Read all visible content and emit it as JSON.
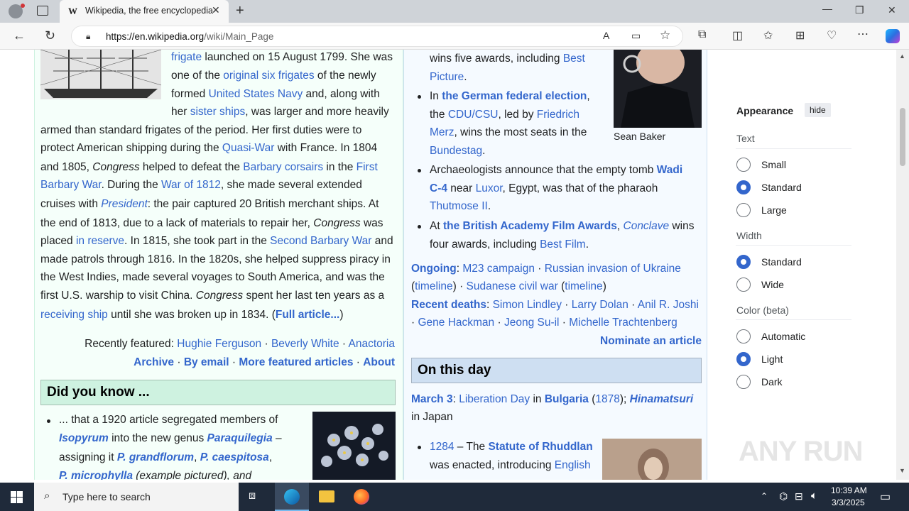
{
  "browser": {
    "tab_title": "Wikipedia, the free encyclopedia",
    "tab_icon": "W",
    "url_host": "https://en.wikipedia.org",
    "url_path": "/wiki/Main_Page"
  },
  "featured": {
    "l1a": "frigate",
    "l1b": " launched on 15 August 1799. She was",
    "l2a": "one of the ",
    "l2b": "original six frigates",
    "l2c": " of the newly",
    "l3a": "formed ",
    "l3b": "United States Navy",
    "l3c": " and, along with",
    "l4a": "her ",
    "l4b": "sister ships",
    "l4c": ", was larger and more heavily",
    "l5": "armed than standard frigates of the period. Her first duties were to",
    "l6a": "protect American shipping during the ",
    "l6b": "Quasi-War",
    "l6c": " with France. In 1804",
    "l7a": "and 1805, ",
    "l7b": "Congress",
    "l7c": " helped to defeat the ",
    "l7d": "Barbary corsairs",
    "l7e": " in the ",
    "l7f": "First",
    "l8a": "Barbary War",
    "l8b": ". During the ",
    "l8c": "War of 1812",
    "l8d": ", she made several extended",
    "l9a": "cruises with ",
    "l9b": "President",
    "l9c": ": the pair captured 20 British merchant ships. At",
    "l10a": "the end of 1813, due to a lack of materials to repair her, ",
    "l10b": "Congress",
    "l10c": " was",
    "l11a": "placed ",
    "l11b": "in reserve",
    "l11c": ". In 1815, she took part in the ",
    "l11d": "Second Barbary War",
    "l11e": " and",
    "l12": "made patrols through 1816. In the 1820s, she helped suppress piracy in",
    "l13": "the West Indies, made several voyages to South America, and was the",
    "l14a": "first U.S. warship to visit China. ",
    "l14b": "Congress",
    "l14c": " spent her last ten years as a",
    "l15a": "receiving ship",
    "l15b": " until she was broken up in 1834. (",
    "l15c": "Full article...",
    "l15d": ")",
    "recently_label": "Recently featured: ",
    "recent1": "Hughie Ferguson",
    "recent2": "Beverly White",
    "recent3": "Anactoria",
    "sep": " · ",
    "archive": "Archive",
    "by_email": "By email",
    "more": "More featured articles",
    "about": "About"
  },
  "dyk": {
    "header": "Did you know ...",
    "d1a": "... that a 1920 article segregated members of",
    "d2a": "Isopyrum",
    "d2b": " into the new genus ",
    "d2c": "Paraquilegia",
    "d2d": " –",
    "d3a": "assigning it ",
    "d3b": "P. grandflorum",
    "d3c": ", ",
    "d3d": "P. caespitosa",
    "d3e": ",",
    "d4a": "P. microphylla",
    "d4b": " (example pictured), and"
  },
  "news": {
    "n0a": "wins five awards, including ",
    "n0b": "Best",
    "n0c": "Picture",
    "n0d": ".",
    "n1a": "In ",
    "n1b": "the German federal election",
    "n1c": ",",
    "n2a": "the ",
    "n2b": "CDU/CSU",
    "n2c": ", led by ",
    "n2d": "Friedrich",
    "n3a": "Merz",
    "n3b": ", wins the most seats in the",
    "n4a": "Bundestag",
    "n4b": ".",
    "n5a": "Archaeologists announce that the empty tomb ",
    "n5b": "Wadi",
    "n6a": "C-4",
    "n6b": " near ",
    "n6c": "Luxor",
    "n6d": ", Egypt, was that of the pharaoh",
    "n7a": "Thutmose II",
    "n7b": ".",
    "n8a": "At ",
    "n8b": "the British Academy Film Awards",
    "n8c": ", ",
    "n8d": "Conclave",
    "n8e": " wins",
    "n9a": "four awards, including ",
    "n9b": "Best Film",
    "n9c": ".",
    "caption": "Sean Baker",
    "ongoing_label": "Ongoing",
    "ongoing1": "M23 campaign",
    "ongoing2": "Russian invasion of Ukraine",
    "paren_open": "(",
    "timeline": "timeline",
    "paren_close": ")",
    "ongoing3": "Sudanese civil war",
    "deaths_label": "Recent deaths",
    "death1": "Simon Lindley",
    "death2": "Larry Dolan",
    "death3": "Anil R. Joshi",
    "death4": "Gene Hackman",
    "death5": "Jeong Su-il",
    "death6": "Michelle Trachtenberg",
    "nominate": "Nominate an article"
  },
  "otd": {
    "header": "On this day",
    "date": "March 3",
    "colon": ": ",
    "event1": "Liberation Day",
    "in": " in ",
    "country": "Bulgaria",
    "year": "1878",
    "event2": "Hinamatsuri",
    "semi": "); ",
    "in_japan": "in Japan",
    "y1": "1284",
    "y1b": " – The ",
    "y1c": "Statute of Rhuddlan",
    "y2a": "was enacted, introducing ",
    "y2b": "English"
  },
  "appearance": {
    "title": "Appearance",
    "hide": "hide",
    "text_label": "Text",
    "small": "Small",
    "standard": "Standard",
    "large": "Large",
    "width_label": "Width",
    "w_standard": "Standard",
    "wide": "Wide",
    "color_label": "Color (beta)",
    "automatic": "Automatic",
    "light": "Light",
    "dark": "Dark"
  },
  "taskbar": {
    "search_placeholder": "Type here to search",
    "time": "10:39 AM",
    "date": "3/3/2025"
  },
  "watermark": "ANY RUN"
}
